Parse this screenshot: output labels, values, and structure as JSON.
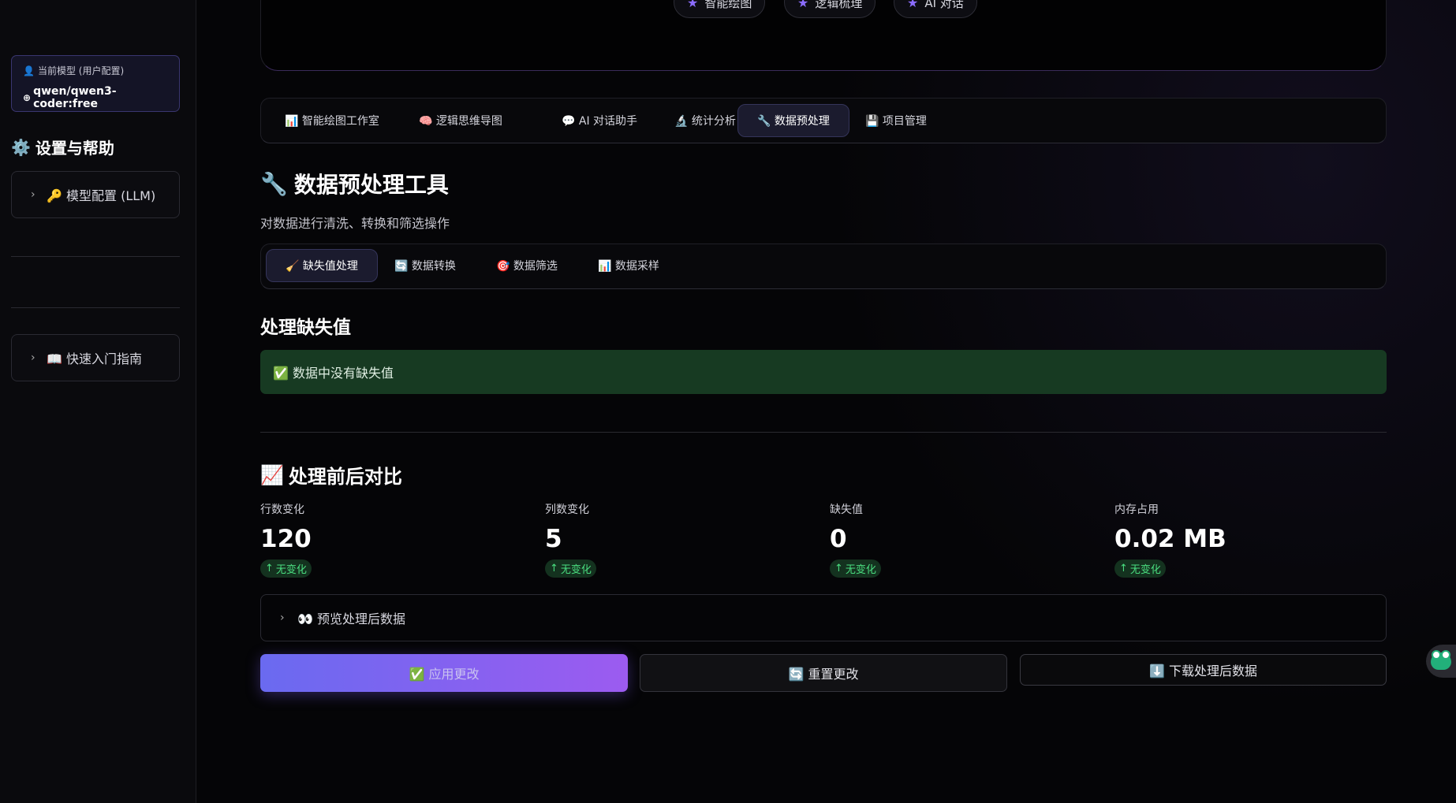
{
  "sidebar": {
    "model_label": "当前模型 (用户配置)",
    "model_value": "qwen/qwen3-coder:free",
    "settings_title": "设置与帮助",
    "llm_expander": "🔑 模型配置 (LLM)",
    "guide_expander": "📖 快速入门指南"
  },
  "hero": {
    "pills": [
      "智能绘图",
      "逻辑梳理",
      "AI 对话"
    ]
  },
  "main_tabs": [
    "📊 智能绘图工作室",
    "🧠 逻辑思维导图",
    "💬 AI 对话助手",
    "🔬 统计分析",
    "🔧 数据预处理",
    "💾 项目管理"
  ],
  "page": {
    "title": "数据预处理工具",
    "title_icon": "🔧",
    "subtitle": "对数据进行清洗、转换和筛选操作"
  },
  "sub_tabs": [
    "🧹 缺失值处理",
    "🔄 数据转换",
    "🎯 数据筛选",
    "📊 数据采样"
  ],
  "missing": {
    "title": "处理缺失值",
    "alert": "✅ 数据中没有缺失值"
  },
  "compare": {
    "title": "处理前后对比",
    "icon": "📈",
    "metrics": [
      {
        "label": "行数变化",
        "value": "120",
        "delta": "无变化"
      },
      {
        "label": "列数变化",
        "value": "5",
        "delta": "无变化"
      },
      {
        "label": "缺失值",
        "value": "0",
        "delta": "无变化"
      },
      {
        "label": "内存占用",
        "value": "0.02 MB",
        "delta": "无变化"
      }
    ]
  },
  "preview_label": "👀 预览处理后数据",
  "buttons": {
    "apply": "✅ 应用更改",
    "reset": "🔄 重置更改",
    "download": "⬇️ 下载处理后数据"
  },
  "colors": {
    "accent_start": "#6a6af0",
    "accent_end": "#9c5bf0",
    "success_bg": "#173a22",
    "delta_text": "#4ade80"
  }
}
